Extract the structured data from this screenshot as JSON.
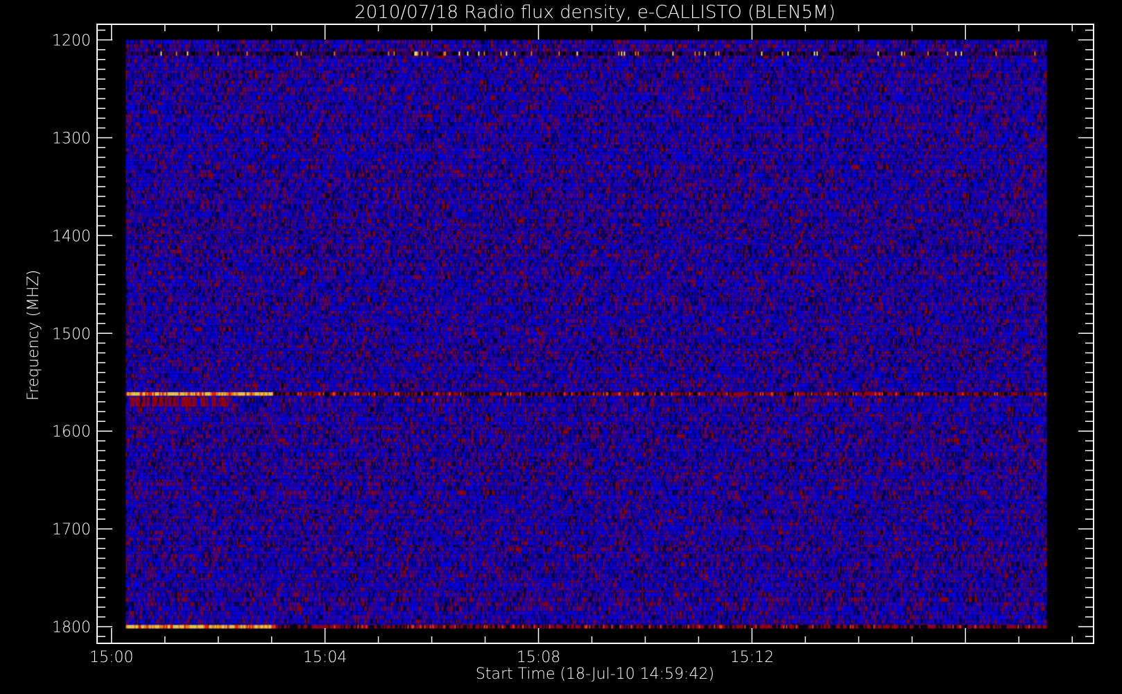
{
  "chart_data": {
    "type": "heatmap",
    "title": "2010/07/18  Radio flux density, e-CALLISTO (BLEN5M)",
    "xlabel": "Start Time (18-Jul-10 14:59:42)",
    "ylabel": "Frequency (MHZ)",
    "x_ticks": [
      "15:00",
      "15:04",
      "15:08",
      "15:12"
    ],
    "x_tick_minutes": [
      0,
      4,
      8,
      12
    ],
    "x_minor_step_minutes": 1,
    "xlim_minutes_after_1500": [
      -0.27,
      18.4
    ],
    "data_time_range_minutes_after_1500": [
      0.27,
      17.5
    ],
    "y_ticks": [
      "1200",
      "1300",
      "1400",
      "1500",
      "1600",
      "1700",
      "1800"
    ],
    "y_tick_values": [
      1200,
      1300,
      1400,
      1500,
      1600,
      1700,
      1800
    ],
    "y_minor_step": 10,
    "ylim": [
      1184,
      1817
    ],
    "y_inverted": true,
    "bright_bands_mhz": [
      {
        "freq": 1215,
        "intensity": "spiky"
      },
      {
        "freq": 1562,
        "intensity": "strong until 15:03"
      },
      {
        "freq": 1800,
        "intensity": "strong until 15:03"
      }
    ],
    "colors": {
      "background": "#000000",
      "low": "#0000ff",
      "mid": "#7000a0",
      "high": "#c00000",
      "peak": "#ffff60"
    }
  }
}
